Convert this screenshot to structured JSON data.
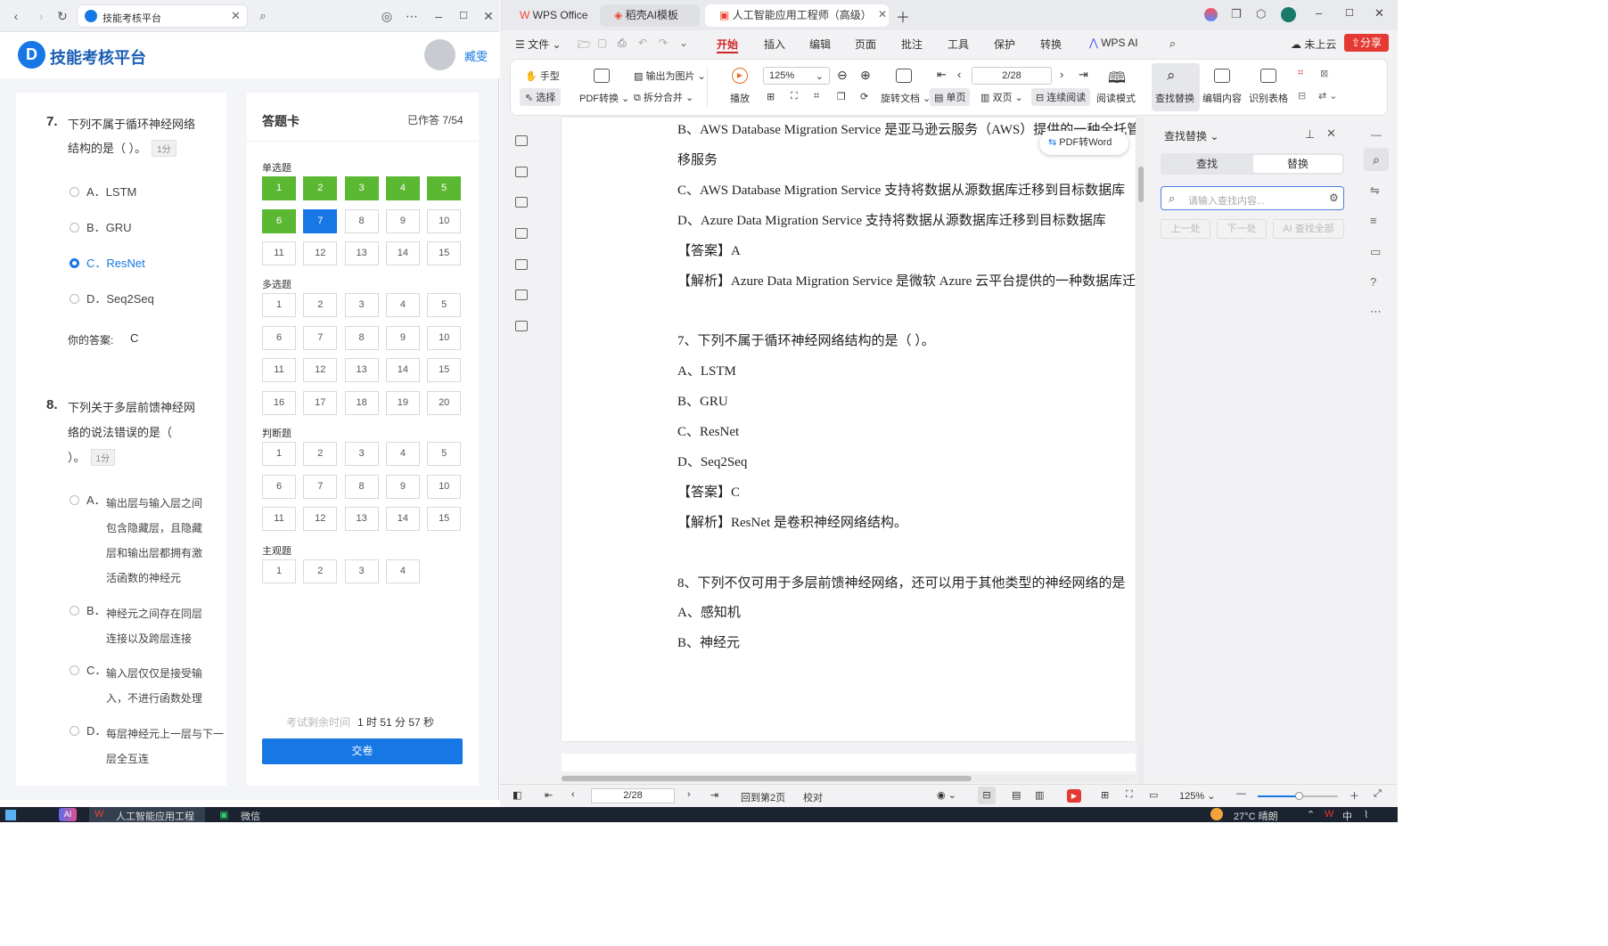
{
  "browser": {
    "tab_title": "技能考核平台",
    "site_name": "技能考核平台",
    "username": "臧雯"
  },
  "question7": {
    "number": "7.",
    "text_line1": "下列不属于循环神经网络",
    "text_line2": "结构的是（   ）。",
    "points": "1分",
    "options": [
      "A．LSTM",
      "B．GRU",
      "C．ResNet",
      "D．Seq2Seq"
    ],
    "selected_index": 2,
    "your_answer_label": "你的答案:",
    "your_answer_value": "C"
  },
  "question8": {
    "number": "8.",
    "text_line1": "下列关于多层前馈神经网",
    "text_line2": "络的说法错误的是（",
    "text_line3": "）。",
    "points": "1分",
    "options": [
      {
        "letter": "A．",
        "lines": [
          "输出层与输入层之间",
          "包含隐藏层，且隐藏",
          "层和输出层都拥有激",
          "活函数的神经元"
        ]
      },
      {
        "letter": "B．",
        "lines": [
          "神经元之间存在同层",
          "连接以及跨层连接"
        ]
      },
      {
        "letter": "C．",
        "lines": [
          "输入层仅仅是接受输",
          "入，不进行函数处理"
        ]
      },
      {
        "letter": "D．",
        "lines": [
          "每层神经元上一层与下一",
          "层全互连"
        ]
      }
    ]
  },
  "answer_card": {
    "title": "答题卡",
    "progress": "已作答 7/54",
    "answered": 7,
    "total": 54,
    "sections": [
      {
        "name": "单选题",
        "count": 15,
        "done": 6,
        "current": 7
      },
      {
        "name": "多选题",
        "count": 20,
        "done": 0,
        "current": 0
      },
      {
        "name": "判断题",
        "count": 15,
        "done": 0,
        "current": 0
      },
      {
        "name": "主观题",
        "count": 4,
        "done": 0,
        "current": 0
      }
    ],
    "time_label": "考试剩余时间",
    "time_value": "1 时 51 分 57 秒",
    "submit": "交卷"
  },
  "wps": {
    "tabs": [
      "WPS Office",
      "稻壳AI模板",
      "人工智能应用工程师（高级）"
    ],
    "menu": [
      "文件",
      "开始",
      "插入",
      "编辑",
      "页面",
      "批注",
      "工具",
      "保护",
      "转换",
      "WPS AI"
    ],
    "active_menu": "开始",
    "cloud": "未上云",
    "share": "分享",
    "ribbon": {
      "hand": "手型",
      "select": "选择",
      "pdf_convert": "PDF转换",
      "export_img": "输出为图片",
      "split_merge": "拆分合并",
      "play": "播放",
      "zoom": "125%",
      "page": "2/28",
      "rotate": "旋转文档",
      "single": "单页",
      "double": "双页",
      "continuous": "连续阅读",
      "read_mode": "阅读模式",
      "find_replace": "查找替换",
      "edit_content": "编辑内容",
      "recognize_table": "识别表格"
    },
    "pdf_to_word": "PDF转Word",
    "doc_lines": [
      "B、AWS Database Migration Service 是亚马逊云服务（AWS）提供的一种全托管",
      "移服务",
      "C、AWS Database Migration Service 支持将数据从源数据库迁移到目标数据库",
      "D、Azure Data Migration Service 支持将数据从源数据库迁移到目标数据库",
      "【答案】A",
      "【解析】Azure Data Migration Service 是微软 Azure 云平台提供的一种数据库迁",
      "",
      "7、下列不属于循环神经网络结构的是（        ）。",
      "A、LSTM",
      "B、GRU",
      "C、ResNet",
      "D、Seq2Seq",
      "【答案】C",
      "【解析】ResNet 是卷积神经网络结构。",
      "",
      "8、下列不仅可用于多层前馈神经网络，还可以用于其他类型的神经网络的是",
      "A、感知机",
      "B、神经元"
    ],
    "find_panel": {
      "title": "查找替换",
      "tab_find": "查找",
      "tab_replace": "替换",
      "placeholder": "请输入查找内容...",
      "prev": "上一处",
      "next": "下一处",
      "find_all": "AI 查找全部"
    },
    "status": {
      "page": "2/28",
      "back": "回到第2页",
      "proof": "校对",
      "zoom": "125%"
    }
  },
  "taskbar": {
    "items": [
      "人工智能应用工程",
      "微信"
    ],
    "weather": "27°C 晴朗",
    "ime": "中"
  }
}
